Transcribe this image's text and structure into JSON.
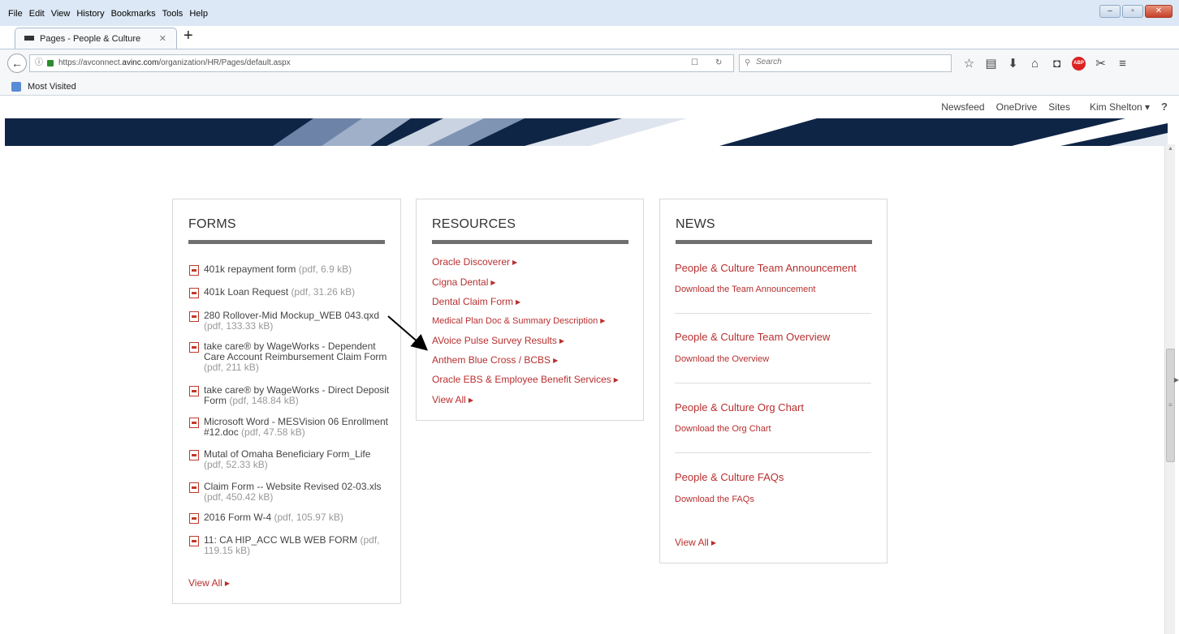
{
  "menubar": {
    "items": [
      "File",
      "Edit",
      "View",
      "History",
      "Bookmarks",
      "Tools",
      "Help"
    ],
    "minimize": "–",
    "maximize": "▫",
    "close": "✕"
  },
  "tab": {
    "title": "Pages - People & Culture",
    "close": "✕",
    "new_tab": "+"
  },
  "navbar": {
    "back": "←",
    "info": "ⓘ",
    "url_prefix": "https://avconnect.",
    "url_domain": "avinc.com",
    "url_path": "/organization/HR/Pages/default.aspx",
    "reader": "☐",
    "reload": "↻",
    "search_icon": "🔍",
    "search_placeholder": "Search",
    "icons": [
      "☆",
      "▤",
      "⬇",
      "⌂",
      "◘",
      "ABP",
      "✂",
      "≡"
    ]
  },
  "bookmarks": {
    "most_visited": "Most Visited"
  },
  "suitebar": {
    "newsfeed": "Newsfeed",
    "onedrive": "OneDrive",
    "sites": "Sites",
    "user": "Kim Shelton ▾",
    "help": "?"
  },
  "scrollbar": {
    "up": "▲",
    "grip": "≡",
    "expand": "▶"
  },
  "forms": {
    "title": "FORMS",
    "items": [
      {
        "name": "401k repayment form",
        "meta": "(pdf, 6.9 kB)"
      },
      {
        "name": "401k Loan Request",
        "meta": "(pdf, 31.26 kB)"
      },
      {
        "name": "280 Rollover-Mid Mockup_WEB 043.qxd",
        "meta": "(pdf, 133.33 kB)"
      },
      {
        "name": "take care® by WageWorks - Dependent Care Account Reimbursement Claim Form",
        "meta": "(pdf, 211 kB)"
      },
      {
        "name": "take care® by WageWorks - Direct Deposit Form",
        "meta": "(pdf, 148.84 kB)"
      },
      {
        "name": "Microsoft Word - MESVision 06 Enrollment #12.doc",
        "meta": "(pdf, 47.58 kB)"
      },
      {
        "name": "Mutal of Omaha Beneficiary Form_Life",
        "meta": "(pdf, 52.33 kB)"
      },
      {
        "name": "Claim Form -- Website Revised 02-03.xls",
        "meta": "(pdf, 450.42 kB)"
      },
      {
        "name": "2016 Form W-4",
        "meta": "(pdf, 105.97 kB)"
      },
      {
        "name": "11: CA HIP_ACC WLB WEB FORM",
        "meta": "(pdf, 119.15 kB)"
      }
    ],
    "view_all": "View All"
  },
  "resources": {
    "title": "RESOURCES",
    "links": [
      "Oracle Discoverer",
      "Cigna Dental",
      "Dental Claim Form",
      "Medical Plan Doc & Summary Description",
      "AVoice Pulse Survey Results",
      "Anthem Blue Cross / BCBS",
      "Oracle EBS & Employee Benefit Services",
      "View All"
    ],
    "arrow": "▶"
  },
  "news": {
    "title": "NEWS",
    "items": [
      {
        "headline": "People & Culture Team Announcement",
        "link": "Download the Team Announcement"
      },
      {
        "headline": "People & Culture Team Overview",
        "link": "Download the Overview"
      },
      {
        "headline": "People & Culture Org Chart",
        "link": "Download the Org Chart"
      },
      {
        "headline": "People & Culture FAQs",
        "link": "Download the FAQs"
      }
    ],
    "view_all": "View All"
  },
  "colors": {
    "link_red": "#b82f2f",
    "banner_navy": "#0f2546",
    "rule_gray": "#6f6f6f"
  }
}
